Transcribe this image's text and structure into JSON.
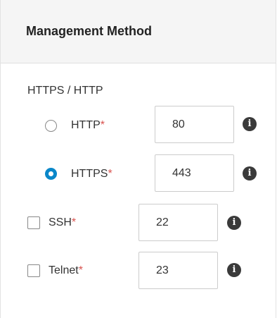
{
  "panel": {
    "title": "Management Method"
  },
  "group": {
    "label": "HTTPS / HTTP"
  },
  "options": {
    "http": {
      "label": "HTTP",
      "required": "*",
      "value": "80",
      "selected": false,
      "icon": "info-icon"
    },
    "https": {
      "label": "HTTPS",
      "required": "*",
      "value": "443",
      "selected": true,
      "icon": "info-icon"
    },
    "ssh": {
      "label": "SSH",
      "required": "*",
      "value": "22",
      "checked": false,
      "icon": "info-icon"
    },
    "telnet": {
      "label": "Telnet",
      "required": "*",
      "value": "23",
      "checked": false,
      "icon": "info-icon"
    }
  },
  "info_glyph": "i",
  "colors": {
    "accent": "#0a87c9",
    "required": "#d9534f",
    "header_bg": "#f5f5f5"
  }
}
